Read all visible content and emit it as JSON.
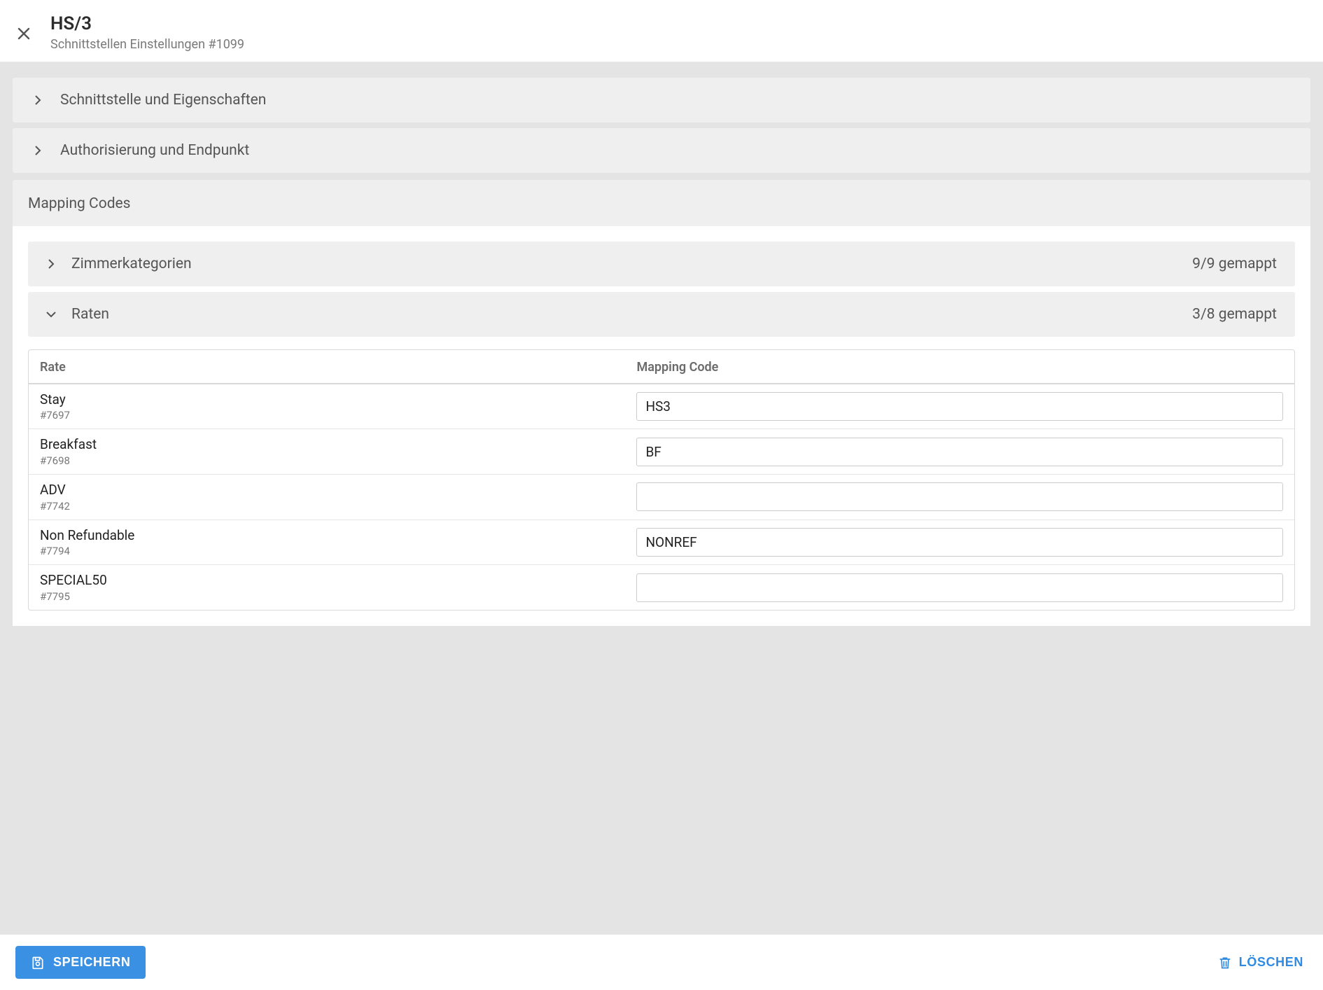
{
  "header": {
    "title": "HS/3",
    "subtitle": "Schnittstellen Einstellungen #1099"
  },
  "panels": {
    "p1": "Schnittstelle und Eigenschaften",
    "p2": "Authorisierung und Endpunkt"
  },
  "mapping": {
    "title": "Mapping Codes",
    "room_cat": {
      "label": "Zimmerkategorien",
      "badge": "9/9 gemappt"
    },
    "rates": {
      "label": "Raten",
      "badge": "3/8 gemappt"
    }
  },
  "table": {
    "head_rate": "Rate",
    "head_code": "Mapping Code",
    "rows": [
      {
        "name": "Stay",
        "id": "#7697",
        "code": "HS3"
      },
      {
        "name": "Breakfast",
        "id": "#7698",
        "code": "BF"
      },
      {
        "name": "ADV",
        "id": "#7742",
        "code": ""
      },
      {
        "name": "Non Refundable",
        "id": "#7794",
        "code": "NONREF"
      },
      {
        "name": "SPECIAL50",
        "id": "#7795",
        "code": ""
      }
    ]
  },
  "footer": {
    "save": "SPEICHERN",
    "delete": "LÖSCHEN"
  }
}
